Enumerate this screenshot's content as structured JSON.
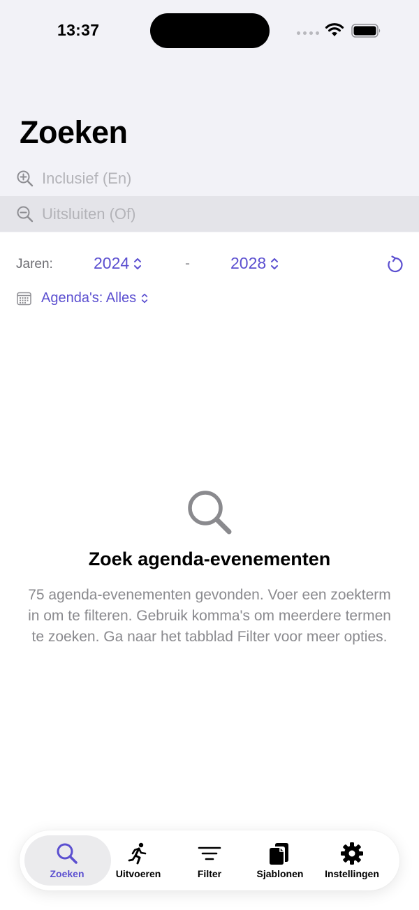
{
  "status_bar": {
    "time": "13:37"
  },
  "header": {
    "title": "Zoeken"
  },
  "search": {
    "include_placeholder": "Inclusief (En)",
    "exclude_placeholder": "Uitsluiten (Of)",
    "include_value": "",
    "exclude_value": ""
  },
  "filters": {
    "years_label": "Jaren:",
    "year_from": "2024",
    "year_separator": "-",
    "year_to": "2028",
    "calendars_label": "Agenda's: Alles"
  },
  "empty_state": {
    "title": "Zoek agenda-evenementen",
    "description": "75 agenda-evenementen gevonden. Voer een zoekterm in om te filteren. Gebruik komma's om meerdere termen te zoeken. Ga naar het tabblad Filter voor meer opties."
  },
  "tab_bar": {
    "items": [
      {
        "label": "Zoeken",
        "icon": "magnifying-glass-icon",
        "active": true
      },
      {
        "label": "Uitvoeren",
        "icon": "running-figure-icon",
        "active": false
      },
      {
        "label": "Filter",
        "icon": "filter-lines-icon",
        "active": false
      },
      {
        "label": "Sjablonen",
        "icon": "documents-icon",
        "active": false
      },
      {
        "label": "Instellingen",
        "icon": "gear-icon",
        "active": false
      }
    ]
  },
  "colors": {
    "accent": "#5b4fd0",
    "header_background": "#f2f2f7",
    "secondary_text": "#8a8a8e"
  }
}
